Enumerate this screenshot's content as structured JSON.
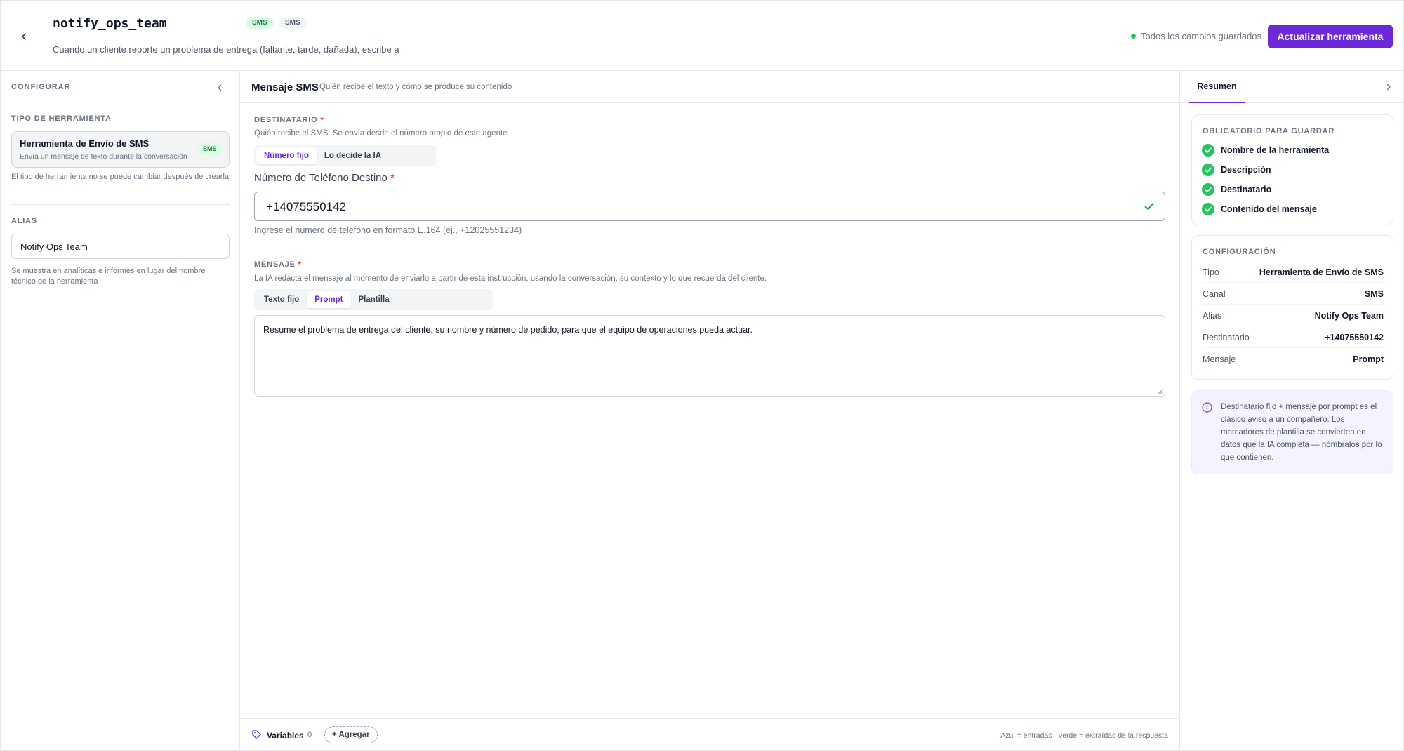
{
  "header": {
    "tool_name": "notify_ops_team",
    "tags": [
      "SMS",
      "SMS"
    ],
    "description": "Cuando un cliente reporte un problema de entrega (faltante, tarde, dañada), escribe a la",
    "save_status": "Todos los cambios guardados",
    "update_button": "Actualizar herramienta"
  },
  "left_panel": {
    "title": "CONFIGURAR",
    "tool_type_label": "TIPO DE HERRAMIENTA",
    "tool_type_name": "Herramienta de Envío de SMS",
    "tool_type_desc": "Envía un mensaje de texto durante la conversación",
    "tool_type_badge": "SMS",
    "tool_type_hint": "El tipo de herramienta no se puede cambiar después de crearla",
    "alias_label": "ALIAS",
    "alias_value": "Notify Ops Team",
    "alias_hint": "Se muestra en analíticas e informes en lugar del nombre técnico de la herramienta"
  },
  "center": {
    "title": "Mensaje SMS",
    "subtitle": "Quién recibe el texto y cómo se produce su contenido",
    "recipient_label": "DESTINATARIO",
    "recipient_help": "Quién recibe el SMS. Se envía desde el número propio de este agente.",
    "recipient_modes": [
      "Número fijo",
      "Lo decide la IA"
    ],
    "recipient_mode_active": "Número fijo",
    "phone_label": "Número de Teléfono Destino",
    "phone_value": "+14075550142",
    "phone_help": "Ingrese el número de teléfono en formato E.164 (ej., +12025551234)",
    "message_label": "MENSAJE",
    "message_help": "La IA redacta el mensaje al momento de enviarlo a partir de esta instrucción, usando la conversación, su contexto y lo que recuerda del cliente.",
    "message_modes": [
      "Texto fijo",
      "Prompt",
      "Plantilla"
    ],
    "message_mode_active": "Prompt",
    "message_value": "Resume el problema de entrega del cliente, su nombre y número de pedido, para que el equipo de operaciones pueda actuar.",
    "required_mark": "*"
  },
  "footer": {
    "variables_label": "Variables",
    "variables_count": "0",
    "add_label": "+ Agregar",
    "legend": "Azul = entradas · verde = extraídas de la respuesta"
  },
  "right_panel": {
    "tab": "Resumen",
    "required_title": "OBLIGATORIO PARA GUARDAR",
    "required_items": [
      "Nombre de la herramienta",
      "Descripción",
      "Destinatario",
      "Contenido del mensaje"
    ],
    "config_title": "CONFIGURACIÓN",
    "config_rows": [
      {
        "key": "Tipo",
        "value": "Herramienta de Envío de SMS"
      },
      {
        "key": "Canal",
        "value": "SMS"
      },
      {
        "key": "Alias",
        "value": "Notify Ops Team"
      },
      {
        "key": "Destinatario",
        "value": "+14075550142"
      },
      {
        "key": "Mensaje",
        "value": "Prompt"
      }
    ],
    "note": "Destinatario fijo + mensaje por prompt es el clásico aviso a un compañero. Los marcadores de plantilla se convierten en datos que la IA completa — nómbralos por lo que contienen."
  },
  "colors": {
    "accent": "#6d28d9",
    "success": "#22c55e",
    "sms_tag_bg": "#dcfce7",
    "sms_tag_text": "#15803d",
    "required": "#dc2626"
  },
  "icons": [
    "chevron-left-icon",
    "chevron-right-icon",
    "status-dot-icon",
    "check-icon",
    "check-circle-icon",
    "tag-icon",
    "info-icon",
    "resize-handle-icon"
  ]
}
